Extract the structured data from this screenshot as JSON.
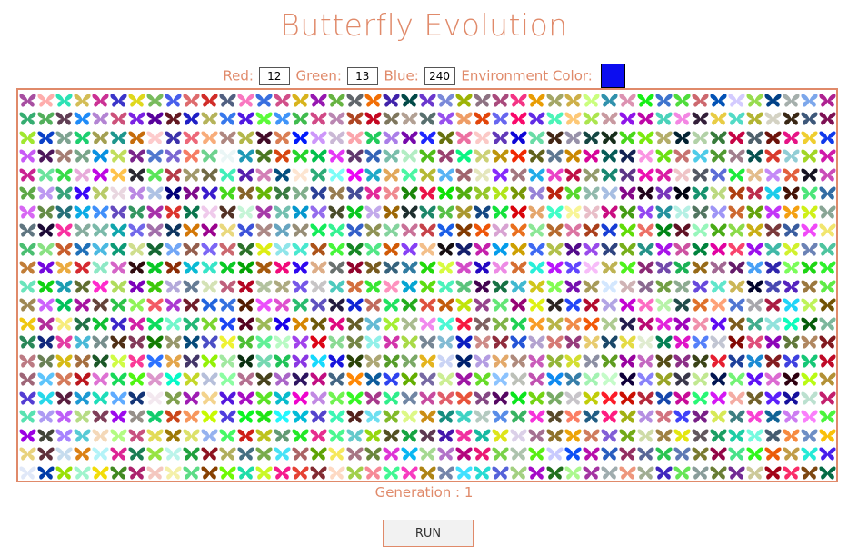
{
  "title": "Butterfly Evolution",
  "controls": {
    "red_label": "Red:",
    "red_value": "12",
    "green_label": "Green:",
    "green_value": "13",
    "blue_label": "Blue:",
    "blue_value": "240",
    "env_label": "Environment Color:",
    "env_color": "#0c0df0"
  },
  "population": {
    "columns": 45,
    "rows": 21,
    "icon": "butterfly-icon"
  },
  "generation": {
    "label": "Generation :",
    "value": "1"
  },
  "run_label": "RUN",
  "colors": {
    "accent": "#e08a6a"
  }
}
